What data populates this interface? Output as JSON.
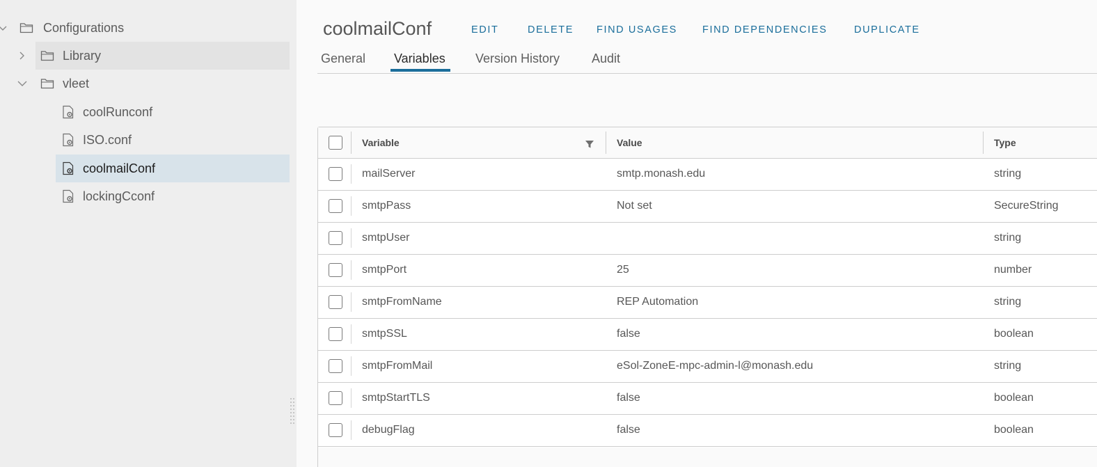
{
  "sidebar": {
    "root": {
      "label": "Configurations",
      "icon": "folder-icon",
      "expand_icon": "chevron-down-icon"
    },
    "folders": [
      {
        "label": "Library",
        "icon": "folder-icon",
        "expand_icon": "chevron-right-icon"
      },
      {
        "label": "vleet",
        "icon": "folder-icon",
        "expand_icon": "chevron-down-icon"
      }
    ],
    "items": [
      {
        "label": "coolRunconf",
        "icon": "config-gear-icon"
      },
      {
        "label": "ISO.conf",
        "icon": "config-gear-icon"
      },
      {
        "label": "coolmailConf",
        "icon": "config-gear-icon",
        "selected": true
      },
      {
        "label": "lockingCconf",
        "icon": "config-gear-icon"
      }
    ]
  },
  "header": {
    "title": "coolmailConf",
    "actions": [
      "EDIT",
      "DELETE",
      "FIND USAGES",
      "FIND DEPENDENCIES",
      "DUPLICATE"
    ]
  },
  "tabs": [
    {
      "label": "General"
    },
    {
      "label": "Variables",
      "active": true
    },
    {
      "label": "Version History"
    },
    {
      "label": "Audit"
    }
  ],
  "table": {
    "columns": [
      "Variable",
      "Value",
      "Type"
    ],
    "rows": [
      {
        "variable": "mailServer",
        "value": "smtp.monash.edu",
        "type": "string"
      },
      {
        "variable": "smtpPass",
        "value": "Not set",
        "type": "SecureString"
      },
      {
        "variable": "smtpUser",
        "value": "",
        "type": "string"
      },
      {
        "variable": "smtpPort",
        "value": "25",
        "type": "number"
      },
      {
        "variable": "smtpFromName",
        "value": "REP Automation",
        "type": "string"
      },
      {
        "variable": "smtpSSL",
        "value": "false",
        "type": "boolean"
      },
      {
        "variable": "smtpFromMail",
        "value": "eSol-ZoneE-mpc-admin-l@monash.edu",
        "type": "string"
      },
      {
        "variable": "smtpStartTLS",
        "value": "false",
        "type": "boolean"
      },
      {
        "variable": "debugFlag",
        "value": "false",
        "type": "boolean"
      }
    ]
  },
  "colors": {
    "accent": "#1b6e9b",
    "sidebar_bg": "#eeeeee",
    "selected_bg": "#d8e3ea"
  }
}
